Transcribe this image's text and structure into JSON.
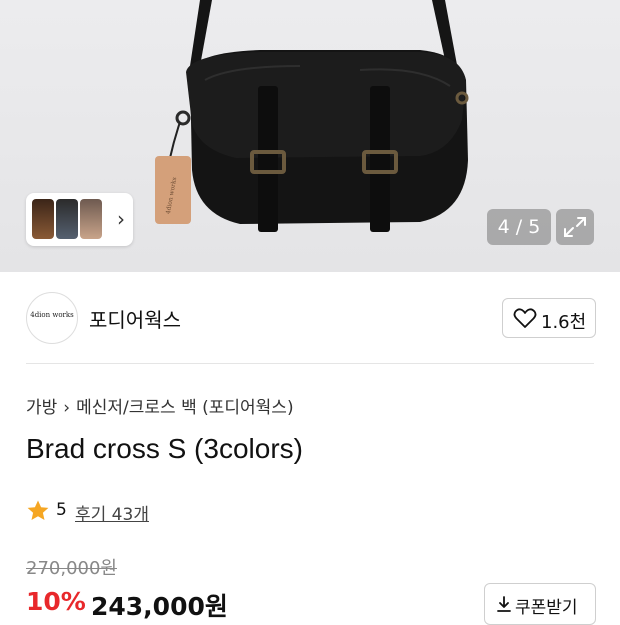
{
  "gallery": {
    "counter": "4 / 5",
    "image_alt": "black leather messenger bag"
  },
  "seller": {
    "name": "포디어웍스",
    "logo_text": "4dion works",
    "like_count": "1.6천"
  },
  "breadcrumb": [
    "가방",
    "메신저/크로스 백 (포디어웍스)"
  ],
  "product": {
    "title": "Brad cross S (3colors)",
    "rating": "5",
    "review_label": "후기 43개",
    "original_price": "270,000원",
    "discount": "10%",
    "price": "243,000원",
    "coupon_label": "쿠폰받기"
  },
  "colors": {
    "discount": "#e8282b",
    "rating_star": "#f5a623"
  }
}
